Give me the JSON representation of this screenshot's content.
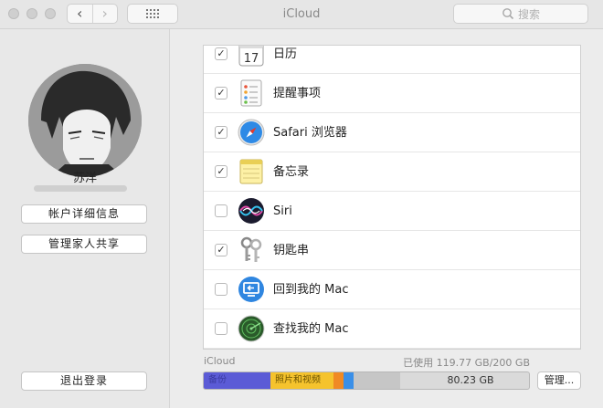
{
  "window": {
    "title": "iCloud"
  },
  "toolbar": {
    "back": "‹",
    "forward": "›",
    "search_placeholder": "搜索"
  },
  "account": {
    "name": "苏洋",
    "details_button": "帐户详细信息",
    "family_button": "管理家人共享",
    "signout_button": "退出登录"
  },
  "services": [
    {
      "label": "日历",
      "checked": true,
      "check": "✓",
      "icon": "calendar-icon",
      "icon_text": "17"
    },
    {
      "label": "提醒事项",
      "checked": true,
      "check": "✓",
      "icon": "reminders-icon"
    },
    {
      "label": "Safari 浏览器",
      "checked": true,
      "check": "✓",
      "icon": "safari-icon"
    },
    {
      "label": "备忘录",
      "checked": true,
      "check": "✓",
      "icon": "notes-icon"
    },
    {
      "label": "Siri",
      "checked": false,
      "check": "",
      "icon": "siri-icon"
    },
    {
      "label": "钥匙串",
      "checked": true,
      "check": "✓",
      "icon": "keychain-icon"
    },
    {
      "label": "回到我的 Mac",
      "checked": false,
      "check": "",
      "icon": "back-to-my-mac-icon"
    },
    {
      "label": "查找我的 Mac",
      "checked": false,
      "check": "",
      "icon": "find-my-mac-icon"
    }
  ],
  "storage": {
    "label": "iCloud",
    "usage": "已使用 119.77 GB/200 GB",
    "free": "80.23 GB",
    "manage_button": "管理...",
    "used_fraction": 0.599,
    "segments": [
      {
        "label": "备份",
        "color": "#5b5bd6",
        "fraction": 0.204
      },
      {
        "label": "照片和视频",
        "color": "#f5c32d",
        "fraction": 0.193
      },
      {
        "label": "",
        "color": "#f08a24",
        "fraction": 0.03
      },
      {
        "label": "",
        "color": "#3a8fe8",
        "fraction": 0.03
      },
      {
        "label": "",
        "color": "#c6c6c6",
        "fraction": 0.142
      }
    ]
  }
}
